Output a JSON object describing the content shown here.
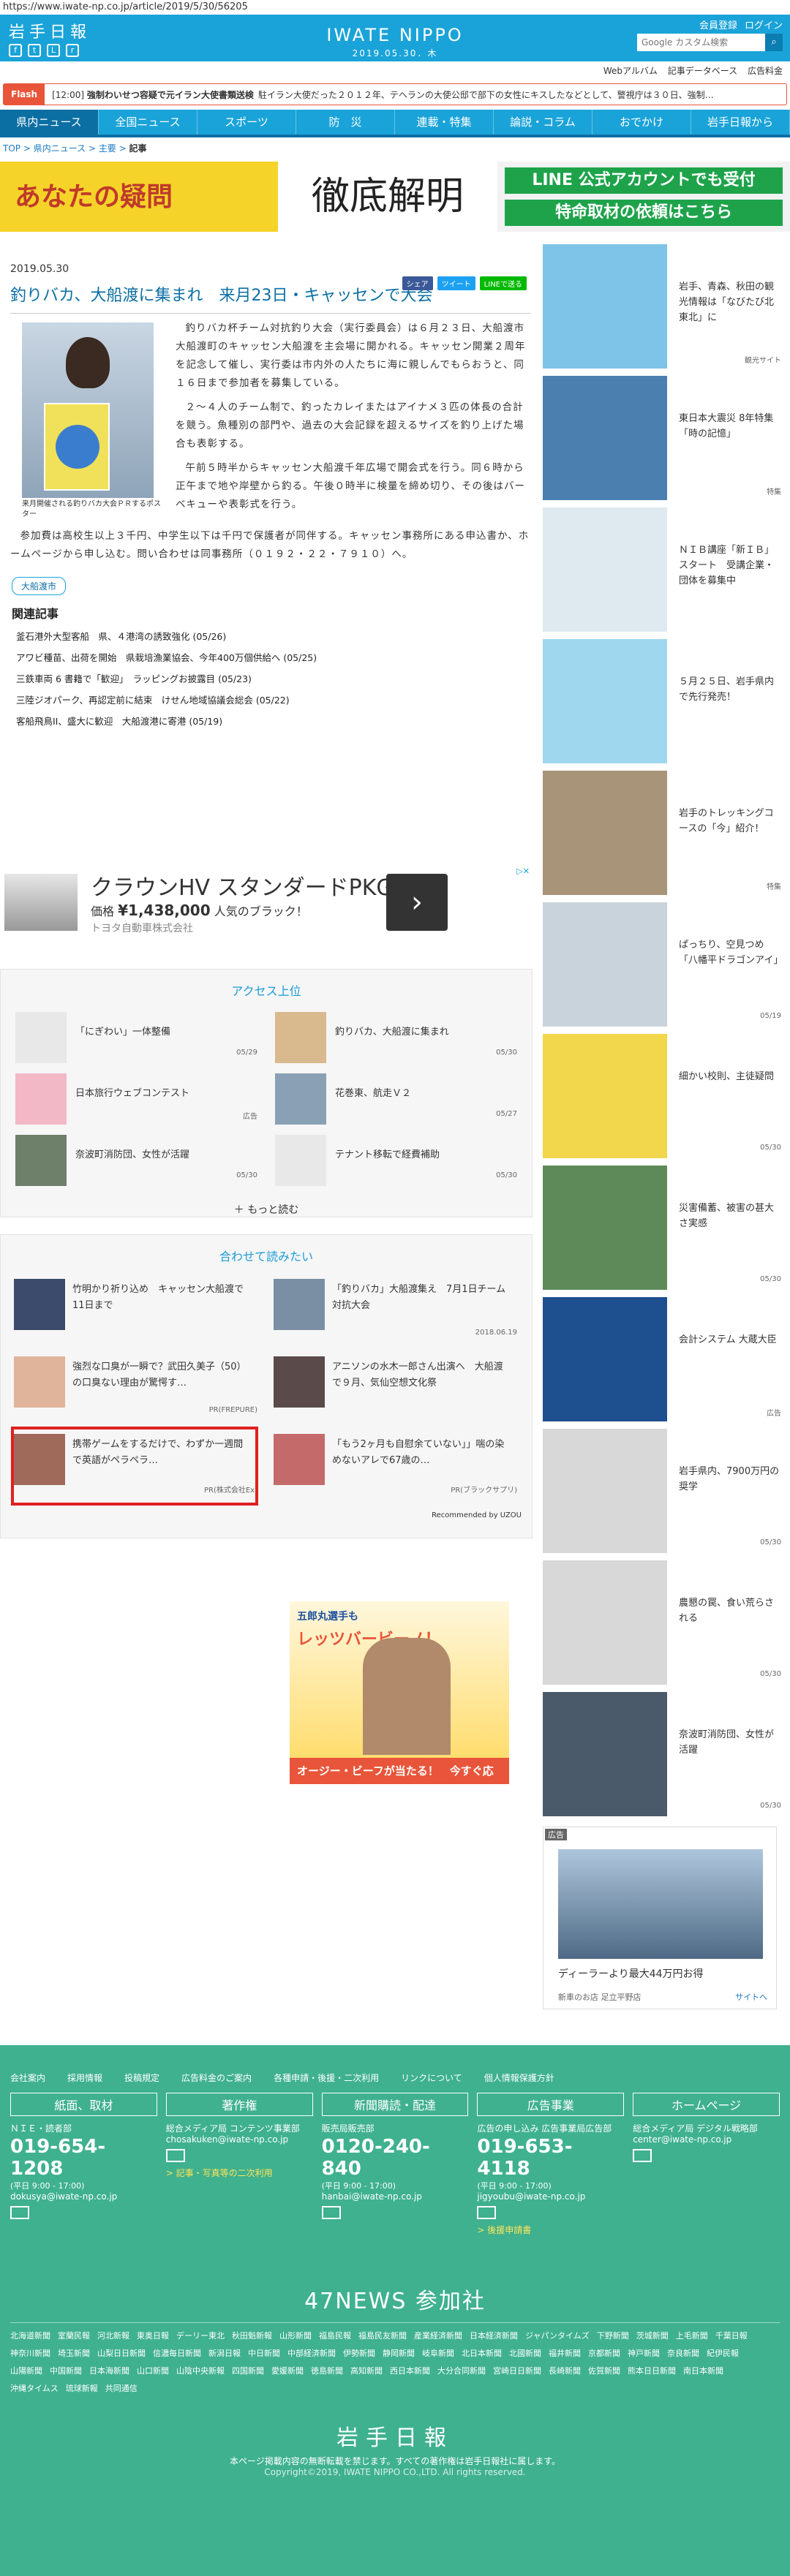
{
  "url": "https://www.iwate-np.co.jp/article/2019/5/30/56205",
  "header": {
    "logo": "岩手日報",
    "brand": "IWATE NIPPO",
    "date": "2019.05.30．木",
    "links": [
      "会員登録",
      "ログイン"
    ],
    "search_placeholder": "Google カスタム検索",
    "search_icon": "magnifier-icon",
    "sublinks": [
      "Webアルバム",
      "記事データベース",
      "広告料金"
    ]
  },
  "flash": {
    "label": "Flash",
    "time": "[12:00]",
    "headline": "強制わいせつ容疑で元イラン大使書類送検",
    "text": "駐イラン大使だった２０１２年、テヘランの大使公邸で部下の女性にキスしたなどとして、警視庁は３０日、強制…"
  },
  "nav": [
    "県内ニュース",
    "全国ニュース",
    "スポーツ",
    "防　災",
    "連載・特集",
    "論説・コラム",
    "おでかけ",
    "岩手日報から"
  ],
  "crumb": {
    "items": [
      "TOP",
      "県内ニュース",
      "主要"
    ],
    "current": "記事"
  },
  "banner": {
    "left": "あなたの疑問",
    "center": "徹底解明",
    "btn1": "LINE 公式アカウントでも受付",
    "btn2": "特命取材の依頼はこちら"
  },
  "article": {
    "date": "2019.05.30",
    "share": [
      "シェア",
      "ツイート",
      "LINEで送る"
    ],
    "title": "釣りバカ、大船渡に集まれ　来月23日・キャッセンで大会",
    "caption": "来月開催される釣りバカ大会ＰＲするポスター",
    "paras": [
      "釣りバカ杯チーム対抗釣り大会（実行委員会）は６月２３日、大船渡市大船渡町のキャッセン大船渡を主会場に開かれる。キャッセン開業２周年を記念して催し、実行委は市内外の人たちに海に親しんでもらおうと、同１６日まで参加者を募集している。",
      "２～４人のチーム制で、釣ったカレイまたはアイナメ３匹の体長の合計を競う。魚種別の部門や、過去の大会記録を超えるサイズを釣り上げた場合も表彰する。",
      "午前５時半からキャッセン大船渡千年広場で開会式を行う。同６時から正午まで地や岸壁から釣る。午後０時半に検量を締め切り、その後はバーベキューや表彰式を行う。",
      "参加費は高校生以上３千円、中学生以下は千円で保護者が同伴する。キャッセン事務所にある申込書か、ホームページから申し込む。問い合わせは同事務所（０１９２・２２・７９１０）へ。"
    ],
    "tag": "大船渡市",
    "related_title": "関連記事",
    "related": [
      "釜石港外大型客船　県、４港湾の誘致強化 (05/26)",
      "アワビ種苗、出荷を開始　県栽培漁業協会、今年400万個供給へ (05/25)",
      "三鉄車両 6 書籍で「歓迎」　ラッピングお披露目 (05/23)",
      "三陸ジオパーク、再認定前に結束　けせん地域協議会総会 (05/22)",
      "客船飛鳥II、盛大に歓迎　大船渡港に寄港 (05/19)"
    ]
  },
  "ad1": {
    "title": "クラウンHV スタンダードPKG",
    "price_label": "価格",
    "price": "¥1,438,000",
    "sub": "人気のブラック！",
    "sponsor": "トヨタ自動車株式会社",
    "go": "›"
  },
  "access": {
    "title": "アクセス上位",
    "items": [
      {
        "t": "「にぎわい」一体整備",
        "d": "05/29"
      },
      {
        "t": "釣りバカ、大船渡に集まれ",
        "d": "05/30"
      },
      {
        "t": "日本旅行ウェブコンテスト",
        "d": "広告"
      },
      {
        "t": "花巻東、航走Ｖ２",
        "d": "05/27"
      },
      {
        "t": "奈波町消防団、女性が活躍",
        "d": "05/30"
      },
      {
        "t": "テナント移転で経費補助",
        "d": "05/30"
      }
    ],
    "more": "もっと読む"
  },
  "reco": {
    "title": "合わせて読みたい",
    "items": [
      {
        "t": "竹明かり祈り込め　キャッセン大船渡で11日まで",
        "p": ""
      },
      {
        "t": "「釣りバカ」大船渡集え　7月1日チーム対抗大会",
        "p": "2018.06.19"
      },
      {
        "t": "強烈な口臭が一瞬で？武田久美子（50）の口臭ない理由が驚愕す…",
        "p": "PR(FREPURE)"
      },
      {
        "t": "アニソンの水木一郎さん出演へ　大船渡で９月、気仙空想文化祭",
        "p": ""
      },
      {
        "t": "携帯ゲームをするだけで、わずか一週間で英語がペラペラ…",
        "p": "PR(株式会社Ex)"
      },
      {
        "t": "「もう2ヶ月も自慰余ていない」」喘の染めないアレで67歳の…",
        "p": "PR(ブラックサプリ)"
      }
    ],
    "credit": "Recommended by UZOU"
  },
  "ad2": {
    "t1": "五郎丸選手も",
    "t2": "レッツバービーノ！",
    "btn": "オージー・ビーフが当たる！　今すぐ応募！"
  },
  "side": [
    {
      "t": "岩手、青森、秋田の観光情報は「なびたび北東北」に",
      "d": "観光サイト"
    },
    {
      "t": "東日本大震災 8年特集 「時の記憶」",
      "d": "特集"
    },
    {
      "t": "ＮＩＢ講座「新ＩＢ」スタート　受講企業・団体を募集中",
      "d": ""
    },
    {
      "t": "５月２５日、岩手県内で先行発売！",
      "d": ""
    },
    {
      "t": "岩手のトレッキングコースの「今」紹介！",
      "d": "特集"
    },
    {
      "t": "ぱっちり、空見つめ「八幡平ドラゴンアイ」",
      "d": "05/19"
    },
    {
      "t": "細かい校則、主徒疑問",
      "d": "05/30"
    },
    {
      "t": "災害備蓄、被害の甚大さ実感",
      "d": "05/30"
    },
    {
      "t": "会計システム 大蔵大臣",
      "d": "広告"
    },
    {
      "t": "岩手県内、7900万円の奨学",
      "d": "05/30"
    },
    {
      "t": "農懇の罠、食い荒らされる",
      "d": "05/30"
    },
    {
      "t": "奈波町消防団、女性が活躍",
      "d": "05/30"
    }
  ],
  "side_ad": {
    "label": "広告",
    "title": "ディーラーより最大44万円お得",
    "sub": "新車のお店 足立平野店",
    "site": "サイトへ"
  },
  "footer": {
    "links": [
      "会社案内",
      "採用情報",
      "投稿規定",
      "広告料金のご案内",
      "各種申請・後援・二次利用",
      "リンクについて",
      "個人情報保護方針"
    ],
    "cols": [
      {
        "h": "紙面、取材",
        "l1": "ＮＩＥ・読者部",
        "ph": "019-654-1208",
        "sm": "(平日 9:00 - 17:00)",
        "mail": "dokusya@iwate-np.co.jp",
        "extra": ""
      },
      {
        "h": "著作権",
        "l1": "総合メディア局 コンテンツ事業部",
        "ph": "",
        "sm": "",
        "mail": "chosakuken@iwate-np.co.jp",
        "extra": "> 記事・写真等の二次利用"
      },
      {
        "h": "新聞購読・配達",
        "l1": "販売局販売部",
        "ph": "0120-240-840",
        "sm": "(平日 9:00 - 17:00)",
        "mail": "hanbai@iwate-np.co.jp",
        "extra": ""
      },
      {
        "h": "広告事業",
        "l1": "広告の申し込み 広告事業局広告部",
        "ph": "019-653-4118",
        "sm": "(平日 9:00 - 17:00)",
        "mail": "jigyoubu@iwate-np.co.jp",
        "extra": "> 後援申請書"
      },
      {
        "h": "ホームページ",
        "l1": "総合メディア局 デジタル戦略部",
        "ph": "",
        "sm": "",
        "mail": "center@iwate-np.co.jp",
        "extra": ""
      }
    ],
    "f47": "47NEWS 参加社",
    "papers": [
      "北海道新聞",
      "室蘭民報",
      "河北新報",
      "東奥日報",
      "デーリー東北",
      "秋田魁新報",
      "山形新聞",
      "福島民報",
      "福島民友新聞",
      "産業経済新聞",
      "日本経済新聞",
      "ジャパンタイムズ",
      "下野新聞",
      "茨城新聞",
      "上毛新聞",
      "千葉日報",
      "神奈川新聞",
      "埼玉新聞",
      "山梨日日新聞",
      "信濃毎日新聞",
      "新潟日報",
      "中日新聞",
      "中部経済新聞",
      "伊勢新聞",
      "静岡新聞",
      "岐阜新聞",
      "北日本新聞",
      "北國新聞",
      "福井新聞",
      "京都新聞",
      "神戸新聞",
      "奈良新聞",
      "紀伊民報",
      "山陽新聞",
      "中国新聞",
      "日本海新聞",
      "山口新聞",
      "山陰中央新報",
      "四国新聞",
      "愛媛新聞",
      "徳島新聞",
      "高知新聞",
      "西日本新聞",
      "大分合同新聞",
      "宮崎日日新聞",
      "長崎新聞",
      "佐賀新聞",
      "熊本日日新聞",
      "南日本新聞",
      "沖縄タイムス",
      "琉球新報",
      "共同通信"
    ],
    "logo": "岩手日報",
    "copy": "本ページ掲載内容の無断転載を禁じます。すべての著作権は岩手日報社に属します。",
    "copy2": "Copyright©2019, IWATE NIPPO CO.,LTD. All rights reserved."
  },
  "colors": {
    "accent": "#1aa3d8",
    "footer": "#3fb18e",
    "flash": "#e8553a",
    "highlight": "#e02020"
  }
}
